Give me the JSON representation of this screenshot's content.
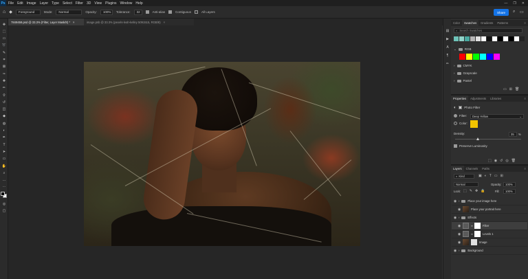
{
  "app": {
    "logo": "Ps",
    "menus": [
      "File",
      "Edit",
      "Image",
      "Layer",
      "Type",
      "Select",
      "Filter",
      "3D",
      "View",
      "Plugins",
      "Window",
      "Help"
    ],
    "window_controls": [
      "—",
      "❐",
      "✕"
    ]
  },
  "options_bar": {
    "home_icon": "home-icon",
    "sample_label": "Foreground",
    "mode_label": "Mode:",
    "mode_value": "Normal",
    "opacity_label": "Opacity:",
    "opacity_value": "100%",
    "tolerance_label": "Tolerance:",
    "tolerance_value": "32",
    "antialias_label": "Anti-alias",
    "contiguous_label": "Contiguous",
    "all_layers_label": "All Layers",
    "share_label": "Share"
  },
  "tabs": [
    {
      "label": "7849459.psd @ 33.3% (Filter, Layer Mask/8) *",
      "active": true,
      "close": "×"
    },
    {
      "label": "image.psb @ 33.3% (pexels-leah-kelley 5091515, RGB/8)",
      "active": false,
      "close": "×"
    }
  ],
  "swatches_panel": {
    "tabs": [
      "Color",
      "Swatches",
      "Gradients",
      "Patterns"
    ],
    "active_tab": "Swatches",
    "search_placeholder": "Search Swatches",
    "recent_colors": [
      "#6ec3b8",
      "#8fd3c9",
      "#4aa9a0",
      "#b6b6b6",
      "#e0e0e0",
      "#ffffff",
      "#111111",
      "#ffffff",
      "#000000",
      "#ffffff",
      "#000000",
      "#ffffff",
      "#222222"
    ],
    "folders": [
      {
        "name": "RGB",
        "expanded": true,
        "colors": [
          "#ff0000",
          "#ffff00",
          "#00ff00",
          "#00ffff",
          "#0000ff",
          "#ff00ff"
        ]
      },
      {
        "name": "CMYK",
        "expanded": false
      },
      {
        "name": "Grayscale",
        "expanded": false
      },
      {
        "name": "Pastel",
        "expanded": false
      }
    ]
  },
  "properties_panel": {
    "tabs": [
      "Properties",
      "Adjustments",
      "Libraries"
    ],
    "active_tab": "Properties",
    "title": "Photo Filter",
    "filter_label": "Filter:",
    "filter_value": "Deep Yellow",
    "color_label": "Color:",
    "color_swatch": "#f2c400",
    "density_label": "Density:",
    "density_value": "35",
    "density_unit": "%",
    "density_fraction": 0.35,
    "preserve_label": "Preserve Luminosity"
  },
  "layers_panel": {
    "tabs": [
      "Layers",
      "Channels",
      "Paths"
    ],
    "active_tab": "Layers",
    "kind_label": "Kind",
    "blend_mode": "Normal",
    "opacity_label": "Opacity:",
    "opacity_value": "100%",
    "lock_label": "Lock:",
    "fill_label": "Fill:",
    "fill_value": "100%",
    "layers": [
      {
        "name": "Place your image here",
        "type": "folder",
        "visible": true,
        "selected": false
      },
      {
        "name": "Place your portrait here",
        "type": "smart",
        "visible": true,
        "selected": false
      },
      {
        "name": "Effects",
        "type": "folder",
        "visible": true,
        "selected": false
      },
      {
        "name": "Filter",
        "type": "adjustment",
        "visible": true,
        "selected": true
      },
      {
        "name": "Levels 1",
        "type": "adjustment",
        "visible": true,
        "selected": false
      },
      {
        "name": "Image",
        "type": "smart",
        "visible": true,
        "selected": false
      },
      {
        "name": "Background",
        "type": "folder",
        "visible": true,
        "selected": false
      }
    ]
  },
  "colors": {
    "accent": "#1473e6",
    "panel_bg": "#2f2f2f",
    "canvas_bg": "#262626"
  }
}
